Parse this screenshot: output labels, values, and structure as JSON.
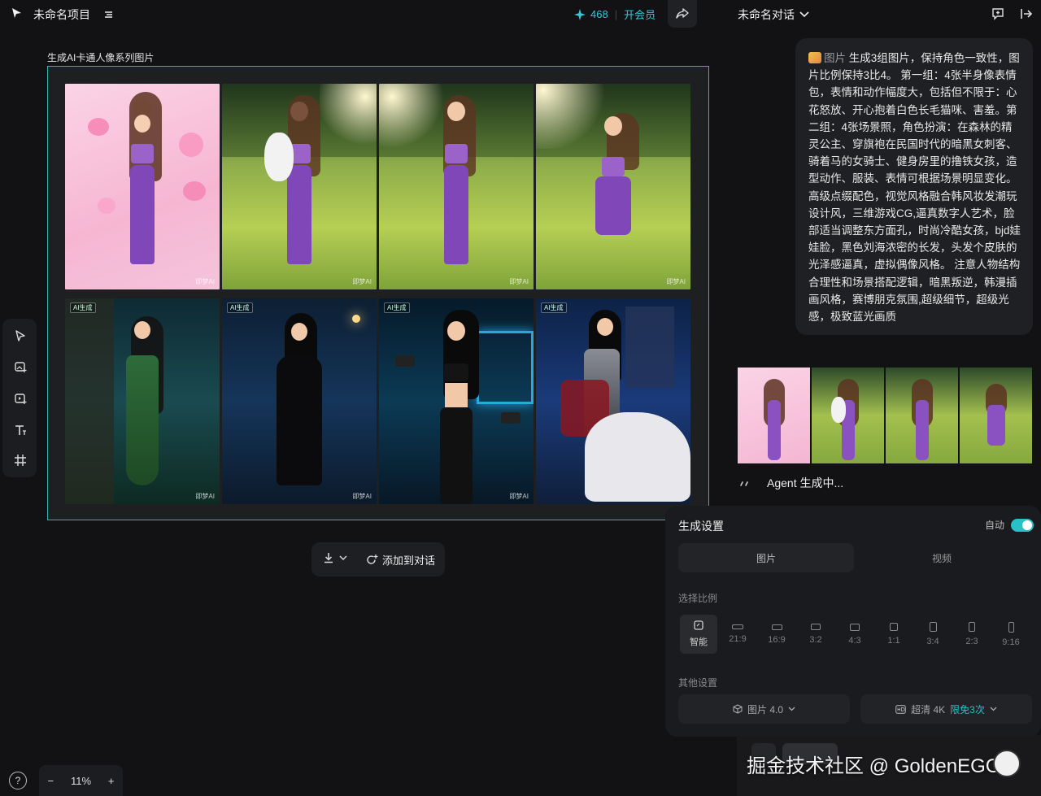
{
  "topbar": {
    "project_title": "未命名项目",
    "credits": "468",
    "membership_label": "开会员",
    "conversation_title": "未命名对话"
  },
  "canvas": {
    "title": "生成AI卡通人像系列图片",
    "ai_tag": "AI生成",
    "watermark": "即梦AI",
    "images": [
      {
        "row": 1,
        "scene": "pink-hearts"
      },
      {
        "row": 1,
        "scene": "meadow-cat"
      },
      {
        "row": 1,
        "scene": "meadow-shy"
      },
      {
        "row": 1,
        "scene": "meadow-jump"
      },
      {
        "row": 2,
        "scene": "forest-elf"
      },
      {
        "row": 2,
        "scene": "night-assassin"
      },
      {
        "row": 2,
        "scene": "gym"
      },
      {
        "row": 2,
        "scene": "knight-horse"
      }
    ]
  },
  "left_toolbar": {
    "tools": [
      "select-tool",
      "image-gen-tool",
      "video-gen-tool",
      "text-tool",
      "crop-tool"
    ]
  },
  "action_bar": {
    "add_to_chat_label": "添加到对话"
  },
  "zoom": {
    "help": "?",
    "minus": "−",
    "level": "11%",
    "plus": "+"
  },
  "chat": {
    "tag": "图片",
    "prompt": "生成3组图片，保持角色一致性，图片比例保持3比4。 第一组：4张半身像表情包，表情和动作幅度大，包括但不限于：心花怒放、开心抱着白色长毛猫咪、害羞。第二组：4张场景照，角色扮演：在森林的精灵公主、穿旗袍在民国时代的暗黑女刺客、骑着马的女骑士、健身房里的撸铁女孩，造型动作、服装、表情可根据场景明显变化。高级点缀配色，视觉风格融合韩风妆发潮玩设计风，三维游戏CG,逼真数字人艺术，脸部适当调整东方面孔，时尚冷酷女孩，bjd娃娃脸，黑色刘海浓密的长发，头发个皮肤的光泽感逼真，虚拟偶像风格。 注意人物结构合理性和场景搭配逻辑，暗黑叛逆，韩漫插画风格，赛博朋克氛围,超级细节，超级光感，极致蓝光画质",
    "agent_status": "Agent 生成中..."
  },
  "settings": {
    "title": "生成设置",
    "auto_label": "自动",
    "auto_on": true,
    "tabs": [
      "图片",
      "视频"
    ],
    "active_tab": "图片",
    "ratio_section": "选择比例",
    "ratios": [
      "智能",
      "21:9",
      "16:9",
      "3:2",
      "4:3",
      "1:1",
      "3:4",
      "2:3",
      "9:16"
    ],
    "selected_ratio": "智能",
    "other_section": "其他设置",
    "model": "图片 4.0",
    "quality": "超清 4K",
    "quality_promo": "限免3次"
  },
  "watermark": "掘金技术社区 @ GoldenEGGs",
  "colors": {
    "accent": "#27c2c8",
    "frame_border": "#2bb6b0",
    "credit": "#36c8d8"
  }
}
